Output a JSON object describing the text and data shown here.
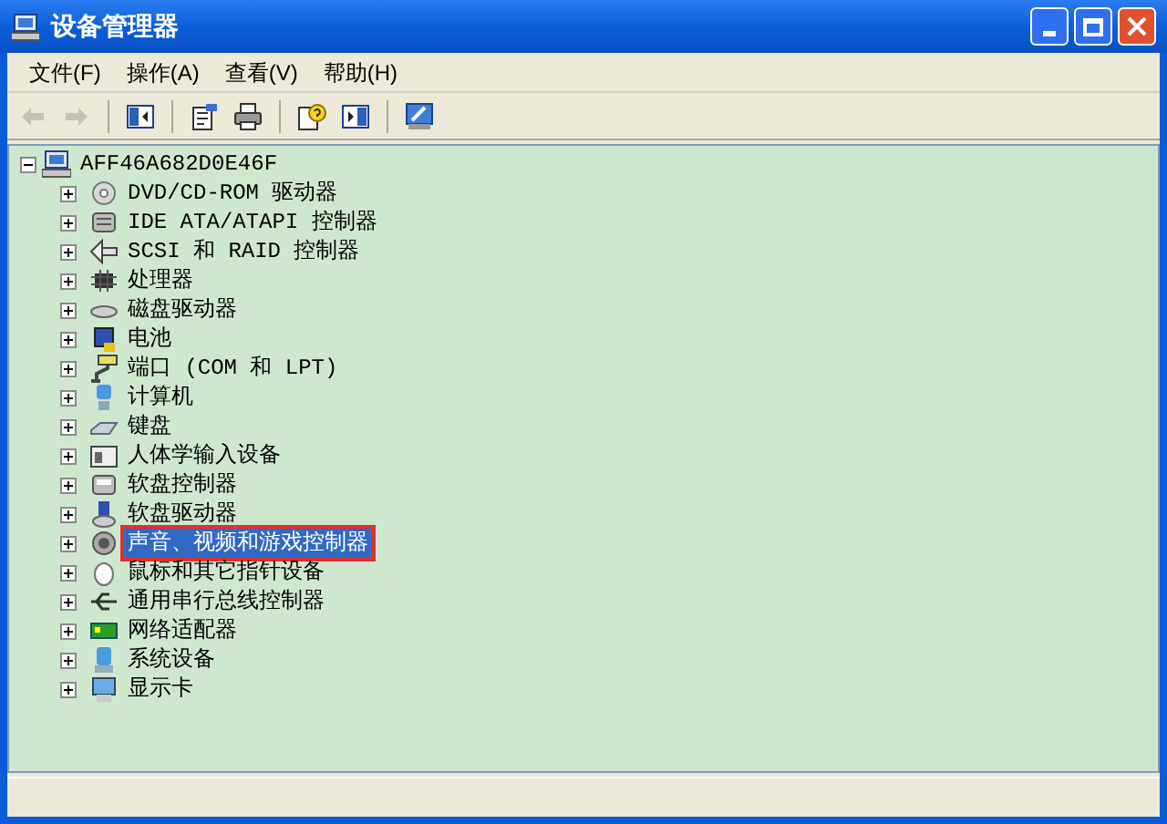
{
  "window": {
    "title": "设备管理器"
  },
  "menu": [
    "文件(F)",
    "操作(A)",
    "查看(V)",
    "帮助(H)"
  ],
  "toolbar": [
    {
      "kind": "back",
      "disabled": true
    },
    {
      "kind": "forward",
      "disabled": true
    },
    {
      "kind": "separator"
    },
    {
      "kind": "tree",
      "disabled": false
    },
    {
      "kind": "separator"
    },
    {
      "kind": "properties",
      "disabled": false
    },
    {
      "kind": "print",
      "disabled": false
    },
    {
      "kind": "separator"
    },
    {
      "kind": "help",
      "disabled": false
    },
    {
      "kind": "panel",
      "disabled": false
    },
    {
      "kind": "separator"
    },
    {
      "kind": "scan",
      "disabled": false
    }
  ],
  "tree": {
    "label": "AFF46A682D0E46F",
    "expanded": true,
    "selected": false,
    "children": [
      {
        "label": "DVD/CD-ROM 驱动器",
        "expanded": false,
        "selected": false
      },
      {
        "label": "IDE ATA/ATAPI 控制器",
        "expanded": false,
        "selected": false
      },
      {
        "label": "SCSI 和 RAID 控制器",
        "expanded": false,
        "selected": false
      },
      {
        "label": "处理器",
        "expanded": false,
        "selected": false
      },
      {
        "label": "磁盘驱动器",
        "expanded": false,
        "selected": false
      },
      {
        "label": "电池",
        "expanded": false,
        "selected": false
      },
      {
        "label": "端口 (COM 和 LPT)",
        "expanded": false,
        "selected": false
      },
      {
        "label": "计算机",
        "expanded": false,
        "selected": false
      },
      {
        "label": "键盘",
        "expanded": false,
        "selected": false
      },
      {
        "label": "人体学输入设备",
        "expanded": false,
        "selected": false
      },
      {
        "label": "软盘控制器",
        "expanded": false,
        "selected": false
      },
      {
        "label": "软盘驱动器",
        "expanded": false,
        "selected": false
      },
      {
        "label": "声音、视频和游戏控制器",
        "expanded": false,
        "selected": true
      },
      {
        "label": "鼠标和其它指针设备",
        "expanded": false,
        "selected": false
      },
      {
        "label": "通用串行总线控制器",
        "expanded": false,
        "selected": false
      },
      {
        "label": "网络适配器",
        "expanded": false,
        "selected": false
      },
      {
        "label": "系统设备",
        "expanded": false,
        "selected": false
      },
      {
        "label": "显示卡",
        "expanded": false,
        "selected": false
      }
    ]
  }
}
